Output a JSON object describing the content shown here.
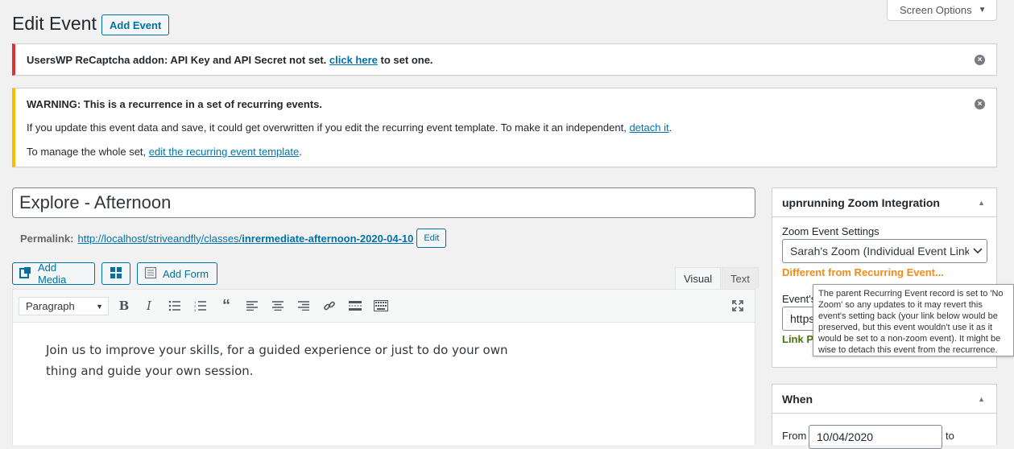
{
  "screen_options": {
    "label": "Screen Options",
    "arrow": "▼"
  },
  "header": {
    "title": "Edit Event",
    "add_button": "Add Event"
  },
  "notice_error": {
    "strong_text": "UsersWP ReCaptcha addon: API Key and API Secret not set.",
    "link_text": "click here",
    "after_text": "to set one."
  },
  "notice_warning": {
    "title": "WARNING: This is a recurrence in a set of recurring events.",
    "line1_text": "If you update this event data and save, it could get overwritten if you edit the recurring event template. To make it an independent,",
    "line1_link": "detach it",
    "line1_end": ".",
    "line2_text": "To manage the whole set,",
    "line2_link": "edit the recurring event template",
    "line2_end": "."
  },
  "post": {
    "title": "Explore - Afternoon",
    "permalink_label": "Permalink:",
    "permalink_base": "http://localhost/striveandfly/classes/",
    "permalink_slug": "inrermediate-afternoon-2020-04-10",
    "edit_button": "Edit"
  },
  "media_buttons": {
    "add_media": "Add Media",
    "add_form": "Add Form"
  },
  "editor": {
    "tabs": {
      "visual": "Visual",
      "text": "Text"
    },
    "format_select": "Paragraph",
    "content": "Join us to improve your skills, for a guided experience or just to do your own thing and guide your own session."
  },
  "zoom_box": {
    "title": "upnrunning Zoom Integration",
    "settings_label": "Zoom Event Settings",
    "selected_option": "Sarah's Zoom (Individual Event Links)",
    "warning": "Different from Recurring Event...",
    "event_link_label": "Event's",
    "link_value": "https",
    "link_preview": "Link Pr",
    "tooltip": "The parent Recurring Event record is set to 'No Zoom' so any updates to it may revert this event's setting back (your link below would be preserved, but this event wouldn't use it as it would be set to a non-zoom event). It might be wise to detach this event from the recurrence."
  },
  "when_box": {
    "title": "When",
    "from_label": "From",
    "from_date": "10/04/2020",
    "to_label": "to"
  },
  "colors": {
    "accent": "#0071a1",
    "error": "#dc3232",
    "warning": "#ffb900",
    "orange": "#f08c1e",
    "green": "#46720f"
  }
}
